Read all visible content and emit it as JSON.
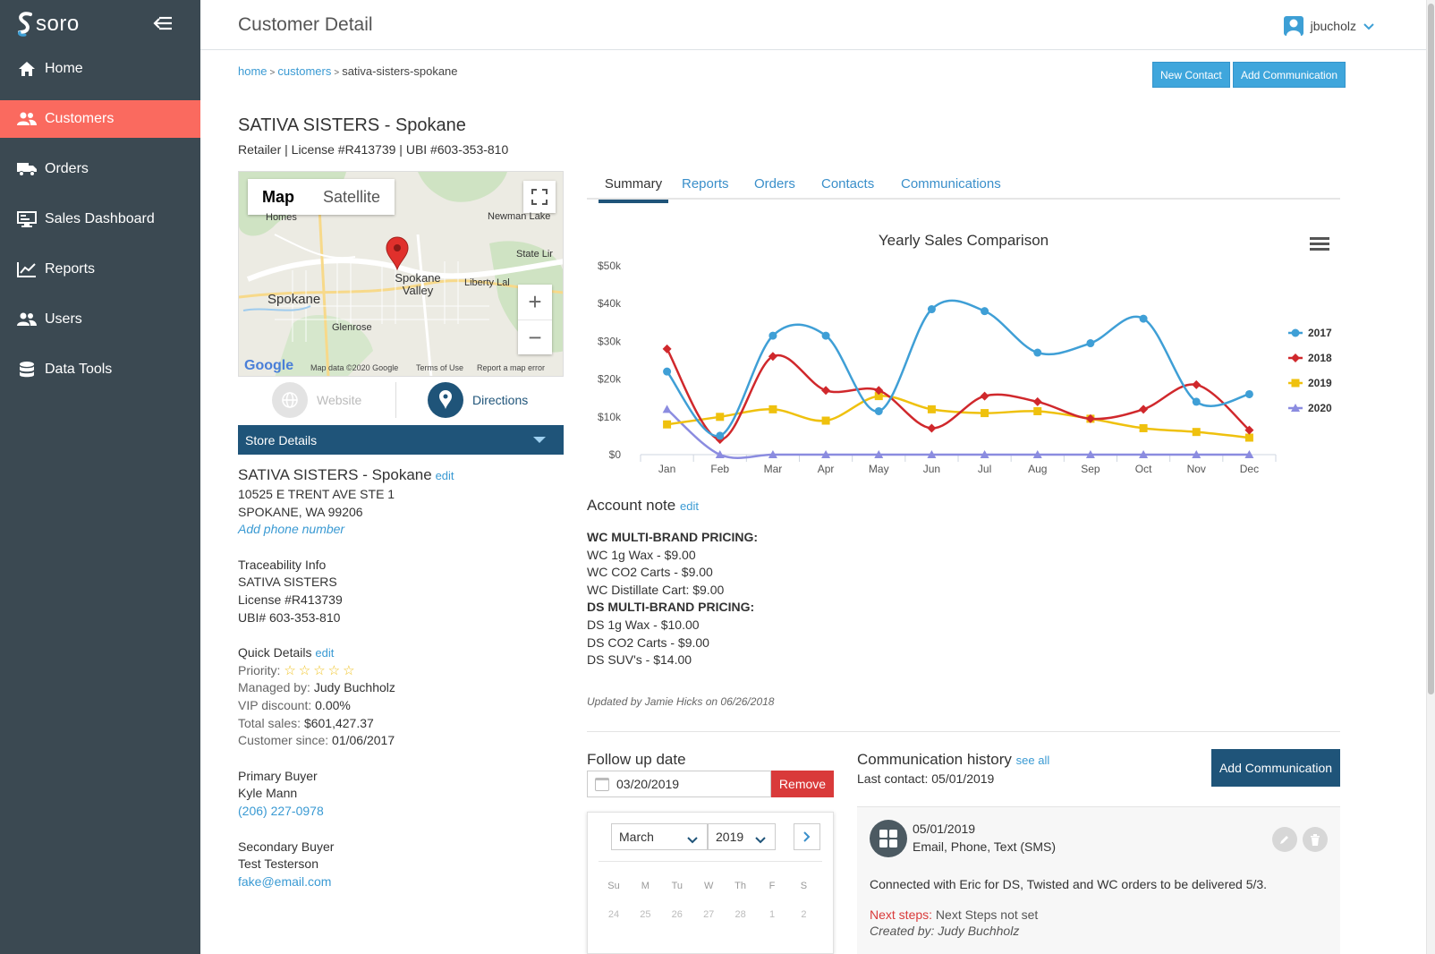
{
  "app": {
    "logo_text": "soro",
    "page_title": "Customer Detail",
    "user_name": "jbucholz"
  },
  "sidebar": {
    "items": [
      {
        "label": "Home",
        "icon": "home-icon"
      },
      {
        "label": "Customers",
        "icon": "users-icon",
        "active": true
      },
      {
        "label": "Orders",
        "icon": "truck-icon"
      },
      {
        "label": "Sales Dashboard",
        "icon": "monitor-icon"
      },
      {
        "label": "Reports",
        "icon": "line-chart-icon"
      },
      {
        "label": "Users",
        "icon": "users-icon"
      },
      {
        "label": "Data Tools",
        "icon": "database-icon"
      }
    ]
  },
  "breadcrumb": {
    "home": "home",
    "customers": "customers",
    "current": "sativa-sisters-spokane"
  },
  "header_buttons": {
    "new_contact": "New Contact",
    "add_communication": "Add Communication"
  },
  "customer": {
    "name": "SATIVA SISTERS - Spokane",
    "subtitle": "Retailer | License #R413739 | UBI #603-353-810"
  },
  "map": {
    "tab_map": "Map",
    "tab_satellite": "Satellite",
    "labels": [
      "Spokane",
      "Spokane Valley",
      "Glenrose",
      "Liberty Lal",
      "Newman Lake",
      "State Lir",
      "Homes"
    ],
    "footer": {
      "brand": "Google",
      "data": "Map data ©2020 Google",
      "terms": "Terms of Use",
      "report": "Report a map error"
    }
  },
  "map_actions": {
    "website": "Website",
    "directions": "Directions"
  },
  "store_details": {
    "bar_label": "Store Details",
    "name": "SATIVA SISTERS - Spokane",
    "edit": "edit",
    "address1": "10525 E TRENT AVE STE 1",
    "address2": "SPOKANE, WA 99206",
    "add_phone": "Add phone number",
    "trace_title": "Traceability Info",
    "trace_name": "SATIVA SISTERS",
    "trace_license": "License #R413739",
    "trace_ubi": "UBI# 603-353-810",
    "quick_title": "Quick Details",
    "quick_edit": "edit",
    "priority_label": "Priority:",
    "priority_stars": 0,
    "priority_max": 5,
    "managed_label": "Managed by:",
    "managed_value": "Judy Buchholz",
    "vip_label": "VIP discount:",
    "vip_value": "0.00%",
    "total_label": "Total sales:",
    "total_value": "$601,427.37",
    "since_label": "Customer since:",
    "since_value": "01/06/2017",
    "primary_title": "Primary Buyer",
    "primary_name": "Kyle Mann",
    "primary_phone": "(206) 227-0978",
    "secondary_title": "Secondary Buyer",
    "secondary_name": "Test Testerson",
    "secondary_email": "fake@email.com"
  },
  "tabs": [
    "Summary",
    "Reports",
    "Orders",
    "Contacts",
    "Communications"
  ],
  "chart_data": {
    "type": "line",
    "title": "Yearly Sales Comparison",
    "categories": [
      "Jan",
      "Feb",
      "Mar",
      "Apr",
      "May",
      "Jun",
      "Jul",
      "Aug",
      "Sep",
      "Oct",
      "Nov",
      "Dec"
    ],
    "y_ticks": [
      "$0",
      "$10k",
      "$20k",
      "$30k",
      "$40k",
      "$50k"
    ],
    "ylim": [
      0,
      50000
    ],
    "legend_position": "right",
    "series": [
      {
        "name": "2017",
        "color": "#3f9fd6",
        "marker": "circle",
        "values": [
          22000,
          5000,
          31500,
          31500,
          11500,
          38500,
          38000,
          27000,
          29500,
          36000,
          14000,
          16000
        ]
      },
      {
        "name": "2018",
        "color": "#d0282c",
        "marker": "diamond",
        "values": [
          28000,
          4000,
          26000,
          17000,
          17000,
          7000,
          15500,
          14000,
          9500,
          12000,
          18500,
          6500
        ]
      },
      {
        "name": "2019",
        "color": "#efc10e",
        "marker": "square",
        "values": [
          8000,
          10000,
          12000,
          9000,
          15500,
          12000,
          11000,
          11500,
          9500,
          7000,
          6000,
          4500
        ]
      },
      {
        "name": "2020",
        "color": "#8b8ce0",
        "marker": "triangle",
        "values": [
          12000,
          0,
          0,
          0,
          0,
          0,
          0,
          0,
          0,
          0,
          0,
          0
        ]
      }
    ]
  },
  "account_note": {
    "title": "Account note",
    "edit": "edit",
    "lines": [
      {
        "text": "WC MULTI-BRAND PRICING:",
        "bold": true
      },
      {
        "text": "WC 1g Wax - $9.00"
      },
      {
        "text": "WC CO2 Carts - $9.00"
      },
      {
        "text": "WC Distillate Cart: $9.00"
      },
      {
        "text": "DS MULTI-BRAND PRICING:",
        "bold": true
      },
      {
        "text": "DS 1g Wax - $10.00"
      },
      {
        "text": "DS CO2 Carts - $9.00"
      },
      {
        "text": "DS SUV's - $14.00"
      }
    ],
    "updated": "Updated by Jamie Hicks on 06/26/2018"
  },
  "follow_up": {
    "title": "Follow up date",
    "value": "03/20/2019",
    "remove": "Remove",
    "month": "March",
    "year": "2019",
    "dow": [
      "Su",
      "M",
      "Tu",
      "W",
      "Th",
      "F",
      "S"
    ],
    "days": [
      "24",
      "25",
      "26",
      "27",
      "28",
      "1",
      "2"
    ]
  },
  "comm_history": {
    "title": "Communication history",
    "see_all": "see all",
    "last_contact": "Last contact: 05/01/2019",
    "add_button": "Add Communication",
    "entry": {
      "date": "05/01/2019",
      "type": "Email, Phone, Text (SMS)",
      "text": "Connected with Eric for DS, Twisted and WC orders to be delivered 5/3.",
      "next_label": "Next steps:",
      "next_value": "Next Steps not set",
      "created": "Created by: Judy Buchholz"
    }
  }
}
